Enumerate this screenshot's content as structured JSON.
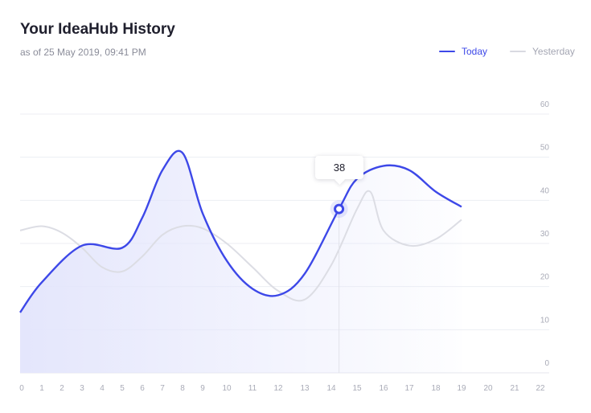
{
  "header": {
    "title": "Your IdeaHub History",
    "subtitle": "as of 25 May 2019, 09:41 PM"
  },
  "legend": {
    "today": "Today",
    "yesterday": "Yesterday"
  },
  "tooltip": {
    "value": "38",
    "x": 14.3
  },
  "colors": {
    "today": "#3d48e8",
    "yesterday": "#dcdde4",
    "fill": "#e4e6fc"
  },
  "chart_data": {
    "type": "line",
    "legend_position": "top-right",
    "x_ticks": [
      "0",
      "1",
      "2",
      "3",
      "4",
      "5",
      "6",
      "7",
      "8",
      "9",
      "10",
      "11",
      "12",
      "13",
      "14",
      "15",
      "16",
      "17",
      "18",
      "19",
      "20",
      "21",
      "22"
    ],
    "y_ticks": [
      "0",
      "10",
      "20",
      "30",
      "40",
      "50",
      "60"
    ],
    "ylim": [
      0,
      60
    ],
    "grid": true,
    "series": [
      {
        "name": "Today",
        "x": [
          0,
          1,
          3,
          5,
          6,
          7,
          8,
          9,
          10,
          11,
          12,
          13,
          14.3,
          15,
          16,
          17,
          18,
          19
        ],
        "y": [
          14,
          21,
          29.5,
          29,
          36,
          47,
          51,
          37,
          26,
          19.5,
          18,
          23,
          38,
          45,
          48,
          47,
          42,
          38.5
        ]
      },
      {
        "name": "Yesterday",
        "x": [
          0,
          1,
          2,
          3,
          4,
          5,
          6,
          7,
          8,
          9,
          10,
          11,
          12,
          13,
          14,
          15,
          15.5,
          16,
          17,
          18,
          19
        ],
        "y": [
          33,
          34,
          32.5,
          29,
          24.5,
          23.5,
          27,
          32,
          34,
          33.5,
          30,
          24.5,
          19,
          17,
          25,
          38,
          42,
          33,
          29.5,
          31,
          35.5
        ]
      }
    ]
  }
}
